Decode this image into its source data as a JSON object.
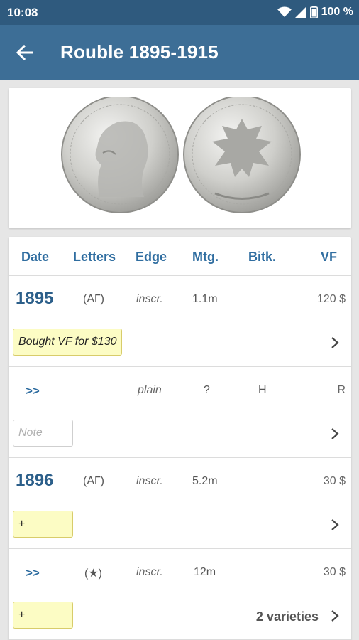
{
  "status_bar": {
    "time": "10:08",
    "battery": "100 %"
  },
  "app_bar": {
    "title": "Rouble 1895-1915",
    "back_icon": "arrow-left-icon"
  },
  "coin": {
    "image": "rouble-obverse-reverse-photo"
  },
  "table": {
    "columns": [
      "Date",
      "Letters",
      "Edge",
      "Mtg.",
      "Bitk.",
      "VF"
    ],
    "rows": [
      {
        "date": "1895",
        "letters": "(АГ)",
        "edge": "inscr.",
        "mintage": "1.1m",
        "bitkin": "",
        "vf": "120 $",
        "note": "Bought VF for $130",
        "note_placeholder": "",
        "varieties": ""
      },
      {
        "date": ">>",
        "letters": "",
        "edge": "plain",
        "mintage": "?",
        "bitkin": "H",
        "vf": "R",
        "note": "",
        "note_placeholder": "Note",
        "varieties": ""
      },
      {
        "date": "1896",
        "letters": "(АГ)",
        "edge": "inscr.",
        "mintage": "5.2m",
        "bitkin": "",
        "vf": "30 $",
        "note": "+",
        "note_placeholder": "",
        "varieties": ""
      },
      {
        "date": ">>",
        "letters": "(★)",
        "edge": "inscr.",
        "mintage": "12m",
        "bitkin": "",
        "vf": "30 $",
        "note": "+",
        "note_placeholder": "",
        "varieties": "2 varieties"
      }
    ]
  },
  "colors": {
    "status_bar": "#2f5a7e",
    "app_bar": "#3d6e96",
    "header_text": "#2f6da0",
    "note_bg": "#fcfcc4"
  }
}
